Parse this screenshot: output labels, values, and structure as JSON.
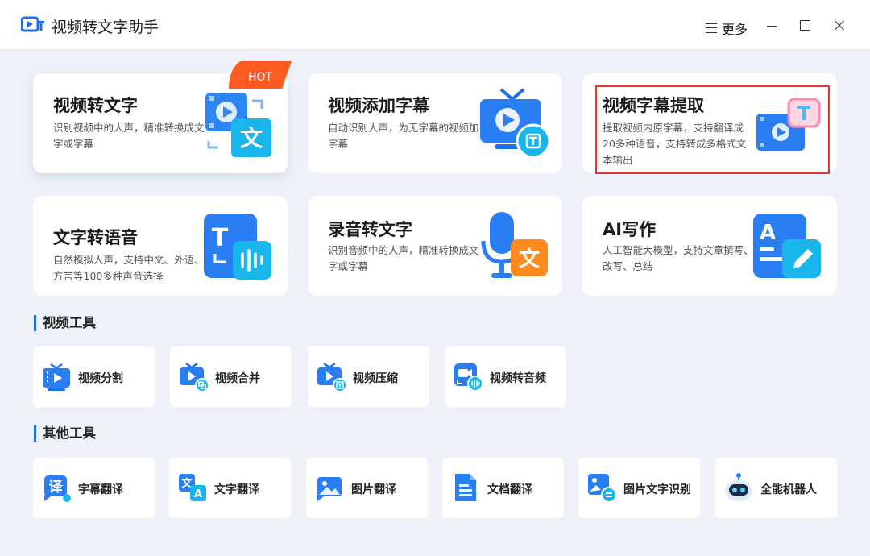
{
  "app": {
    "title": "视频转文字助手",
    "more_label": "更多"
  },
  "cards": [
    {
      "title": "视频转文字",
      "desc": "识别视频中的人声，精准转换成文字或字幕",
      "badge": "HOT"
    },
    {
      "title": "视频添加字幕",
      "desc": "自动识别人声，为无字幕的视频加字幕"
    },
    {
      "title": "视频字幕提取",
      "desc": "提取视频内原字幕，支持翻译成20多种语音，支持转成多格式文本输出"
    },
    {
      "title": "文字转语音",
      "desc": "自然模拟人声，支持中文、外语、方言等100多种声音选择"
    },
    {
      "title": "录音转文字",
      "desc": "识别音频中的人声，精准转换成文字或字幕"
    },
    {
      "title": "AI写作",
      "desc": "人工智能大模型，支持文章撰写、改写、总结"
    }
  ],
  "video_tools": {
    "title": "视频工具",
    "items": [
      {
        "label": "视频分割"
      },
      {
        "label": "视频合并"
      },
      {
        "label": "视频压缩"
      },
      {
        "label": "视频转音频"
      }
    ]
  },
  "other_tools": {
    "title": "其他工具",
    "items": [
      {
        "label": "字幕翻译"
      },
      {
        "label": "文字翻译"
      },
      {
        "label": "图片翻译"
      },
      {
        "label": "文档翻译"
      },
      {
        "label": "图片文字识别"
      },
      {
        "label": "全能机器人"
      }
    ]
  },
  "glyphs": {
    "wen": "文",
    "T": "T",
    "A": "A",
    "yi": "译"
  },
  "colors": {
    "accent": "#1e6ff0",
    "hot": "#ff5a1f",
    "highlight": "#e23b2c",
    "orange": "#ff8a1f"
  }
}
